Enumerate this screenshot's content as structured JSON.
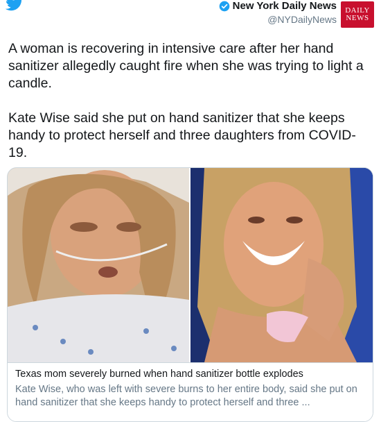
{
  "account": {
    "name": "New York Daily News",
    "handle": "@NYDailyNews",
    "avatar_text_line1": "DAILY",
    "avatar_text_line2": "NEWS",
    "brand_color": "#c8102e",
    "verified_color": "#1da1f2",
    "bird_color": "#1da1f2"
  },
  "tweet": {
    "paragraph1": "A woman is recovering in intensive care after her hand sanitizer allegedly caught fire when she was trying to light a candle.",
    "paragraph2": "Kate Wise said she put on hand sanitizer that she keeps handy to protect herself and three daughters from COVID-19."
  },
  "card": {
    "title": "Texas mom severely burned when hand sanitizer bottle explodes",
    "description": "Kate Wise, who was left with severe burns to her entire body, said she put on hand sanitizer that she keeps handy to protect herself and three ..."
  },
  "icons": {
    "bird": "twitter-bird-icon",
    "verified": "verified-badge-icon"
  }
}
